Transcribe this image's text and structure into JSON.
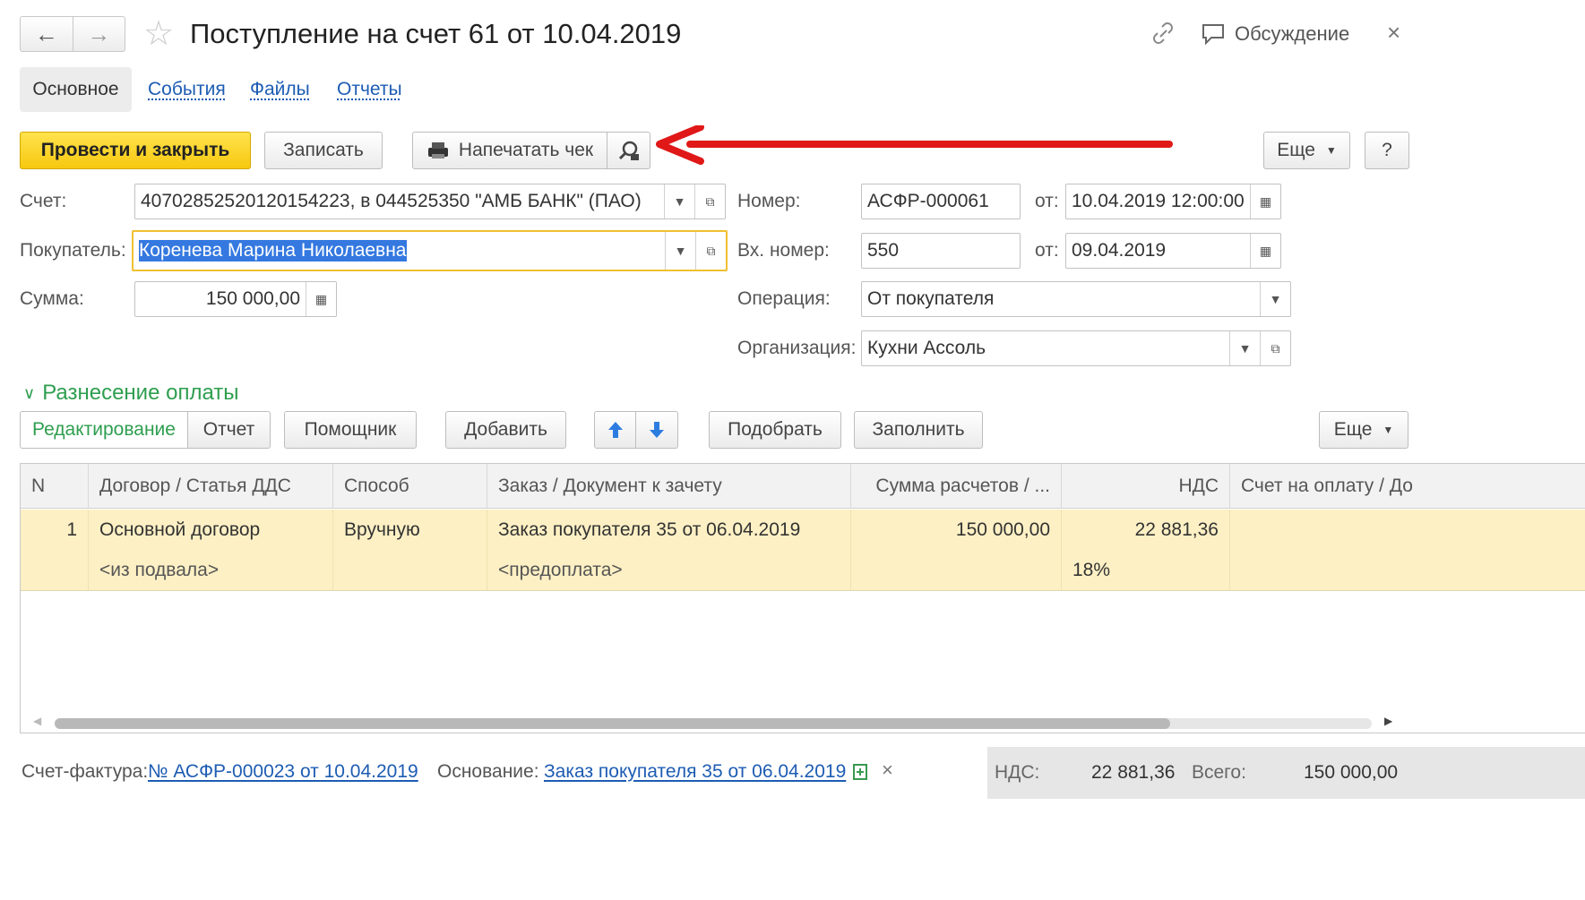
{
  "title_bar": {
    "back_glyph": "←",
    "forward_glyph": "→",
    "title": "Поступление на счет 61 от 10.04.2019",
    "discussion_label": "Обсуждение",
    "close_glyph": "×"
  },
  "tabs": {
    "active": "Основное",
    "links": [
      "События",
      "Файлы",
      "Отчеты"
    ]
  },
  "toolbar": {
    "post_close_label": "Провести и закрыть",
    "save_label": "Записать",
    "print_receipt_label": "Напечатать чек",
    "more_label": "Еще",
    "help_label": "?"
  },
  "form": {
    "account_label": "Счет:",
    "account_value": "40702852520120154223, в 044525350 \"АМБ БАНК\" (ПАО)",
    "buyer_label": "Покупатель:",
    "buyer_value": "Коренева Марина Николаевна",
    "sum_label": "Сумма:",
    "sum_value": "150 000,00",
    "number_label": "Номер:",
    "number_value": "АСФР-000061",
    "date_from_label": "от:",
    "date_value": "10.04.2019 12:00:00",
    "in_number_label": "Вх. номер:",
    "in_number_value": "550",
    "in_date_from_label": "от:",
    "in_date_value": "09.04.2019",
    "operation_label": "Операция:",
    "operation_value": "От покупателя",
    "organization_label": "Организация:",
    "organization_value": "Кухни Ассоль"
  },
  "section": {
    "title": "Разнесение оплаты",
    "edit_tab": "Редактирование",
    "report_tab": "Отчет",
    "assistant_label": "Помощник",
    "add_label": "Добавить",
    "pick_label": "Подобрать",
    "fill_label": "Заполнить",
    "more_label": "Еще"
  },
  "table": {
    "headers": [
      "N",
      "Договор / Статья ДДС",
      "Способ",
      "Заказ / Документ к зачету",
      "Сумма расчетов / ...",
      "НДС",
      "Счет на оплату / До"
    ],
    "rows": [
      {
        "n": "1",
        "contract": "Основной договор",
        "method": "Вручную",
        "order": "Заказ покупателя 35 от 06.04.2019",
        "sum": "150 000,00",
        "vat": "22 881,36",
        "invoice": "",
        "contract_sub": "<из подвала>",
        "order_sub": "<предоплата>",
        "vat_rate": "18%"
      }
    ]
  },
  "footer": {
    "invoice_label": "Счет-фактура:",
    "invoice_link": "№ АСФР-000023  от 10.04.2019",
    "basis_label": "Основание:",
    "basis_link": "Заказ покупателя 35 от 06.04.2019",
    "remove_glyph": "×",
    "vat_label": "НДС:",
    "vat_value": "22 881,36",
    "total_label": "Всего:",
    "total_value": "150 000,00"
  },
  "colors": {
    "primary_button": "#f7c80f",
    "section_green": "#2e9e4f",
    "link_blue": "#1d5cb3",
    "row_highlight": "#fdf0c4",
    "annotation_red": "#e01818"
  }
}
